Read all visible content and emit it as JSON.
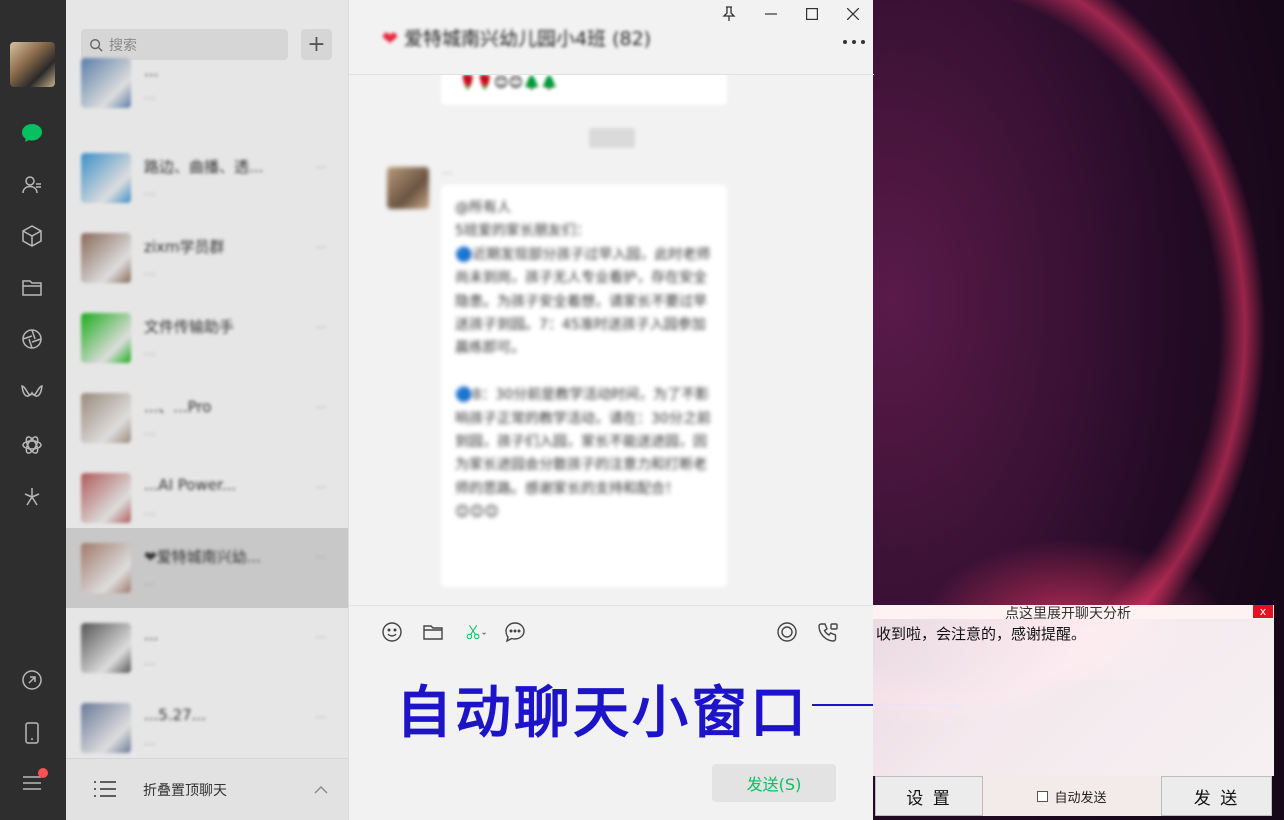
{
  "sidebar": {
    "icons": [
      "chat-icon",
      "contacts-icon",
      "favorites-icon",
      "files-icon",
      "moments-icon",
      "channels-icon",
      "miniprogram-icon",
      "search-discover-icon",
      "link-icon",
      "phone-icon",
      "menu-icon"
    ],
    "active_color": "#07c160"
  },
  "search": {
    "placeholder": "搜索",
    "add_label": "+"
  },
  "chats": [
    {
      "name": "...",
      "msg": "...",
      "time": "",
      "avatar_color": "#5a7ea8"
    },
    {
      "name": "路边、曲播、透...",
      "msg": "...",
      "time": "...",
      "avatar_color": "#3b8fc9"
    },
    {
      "name": "zixm学员群",
      "msg": "...",
      "time": "...",
      "avatar_color": "#8a6a5a"
    },
    {
      "name": "文件传输助手",
      "msg": "...",
      "time": "...",
      "avatar_color": "#1aad19"
    },
    {
      "name": "...、...Pro",
      "msg": "...",
      "time": "...",
      "avatar_color": "#9a8a7a"
    },
    {
      "name": "...AI Power...",
      "msg": "...",
      "time": "...",
      "avatar_color": "#b05a5a"
    },
    {
      "name": "❤爱特城南兴幼...",
      "msg": "...",
      "time": "...",
      "avatar_color": "#a07a6a"
    },
    {
      "name": "...",
      "msg": "...",
      "time": "...",
      "avatar_color": "#555555"
    },
    {
      "name": "...5.27...",
      "msg": "...",
      "time": "...",
      "avatar_color": "#6a7a9a"
    }
  ],
  "fold": {
    "label": "折叠置顶聊天"
  },
  "chat": {
    "title": "爱特城南兴幼儿园小4班 (82)",
    "top_bubble": "🌹🌹😊😊🌲🌲",
    "sender": "...",
    "message": "@所有人\n5班爱的家长朋友们：\n🔵近期发现部分孩子过早入园，此时老师尚未到岗，孩子无人专业看护，存在安全隐患。为孩子安全着想，请家长不要过早送孩子到园。7：45准时送孩子入园参加晨练即可。\n\n🔵8：30分前是教学活动时间，为了不影响孩子正常的教学活动，请在：30分之前到园，孩子们入园，家长不能送进园，因为家长进园会分散孩子的注意力和打断老师的思路。感谢家长的支持和配合！\n😊😊😊",
    "send_label": "发送(S)"
  },
  "overlay": {
    "label": "自动聊天小窗口",
    "color": "#1d14c9"
  },
  "mini_window": {
    "title": "点这里展开聊天分析",
    "close_label": "x",
    "reply_text": "收到啦，会注意的，感谢提醒。",
    "settings_label": "设 置",
    "auto_send_label": "自动发送",
    "send_label": "发 送"
  }
}
